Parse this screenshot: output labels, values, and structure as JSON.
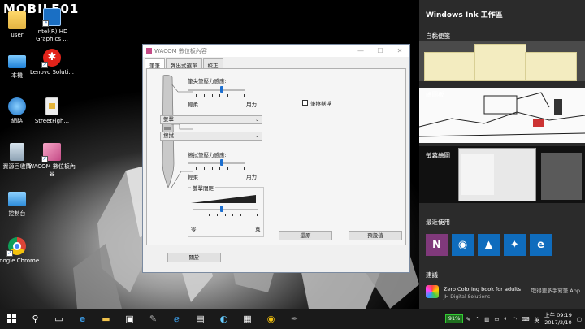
{
  "watermark": "MOBILE01",
  "desktop": {
    "icons": [
      {
        "label": "user",
        "icon": "user-folder-icon"
      },
      {
        "label": "Intel(R) HD Graphics ...",
        "icon": "intel-graphics-icon"
      },
      {
        "label": "本機",
        "icon": "this-pc-icon"
      },
      {
        "label": "Lenovo Soluti...",
        "icon": "lenovo-solutions-icon"
      },
      {
        "label": "網路",
        "icon": "network-icon"
      },
      {
        "label": "StreetFigh...",
        "icon": "file-icon"
      },
      {
        "label": "資源回收筒",
        "icon": "recycle-bin-icon"
      },
      {
        "label": "WACOM 數位板內容",
        "icon": "wacom-icon"
      },
      {
        "label": "控制台",
        "icon": "control-panel-icon"
      },
      {
        "label": "Google Chrome",
        "icon": "chrome-icon"
      }
    ]
  },
  "wacom": {
    "title": "WACOM 數位板內容",
    "tabs": [
      "筆筆",
      "彈出式選單",
      "校正"
    ],
    "tip_feel_label": "筆尖筆壓力感應:",
    "soft_label": "輕柔",
    "firm_label": "用力",
    "tip_feel_value": 0.6,
    "double_click_label": "筆尖雙擊",
    "side_button_upper": "雙擊",
    "side_button_lower": "擦拭",
    "eraser_feel_label": "擦拭筆壓力感應:",
    "eraser_soft": "輕柔",
    "eraser_firm": "用力",
    "eraser_feel_value": 0.6,
    "double_click_distance_label": "雙擊間距",
    "distance_off": "零",
    "distance_large": "寬",
    "distance_value": 0.45,
    "checkbox_label": "筆擦懸浮",
    "default_button": "還原",
    "reset_button": "預設值",
    "about_button": "關於"
  },
  "ink": {
    "title": "Windows Ink 工作區",
    "sticky_notes": "自黏便箋",
    "sketchpad": "繪圖板",
    "screen_sketch": "螢幕繪圖",
    "recent": "最近使用",
    "suggested": "建議",
    "suggest_app_name": "Zero Coloring book for adults",
    "suggest_app_publisher": "JH Digital Solutions",
    "suggest_link": "取得更多手寫筆 App"
  },
  "taskbar": {
    "battery": "91%",
    "time": "上午 09:19",
    "date": "2017/2/10"
  },
  "colors": {
    "accent": "#1c6fd0",
    "ink_bg": "#2b2b2b",
    "taskbar_bg": "#1a1a1a",
    "sticky": "#f3ecc0",
    "onenote": "#80397b"
  }
}
